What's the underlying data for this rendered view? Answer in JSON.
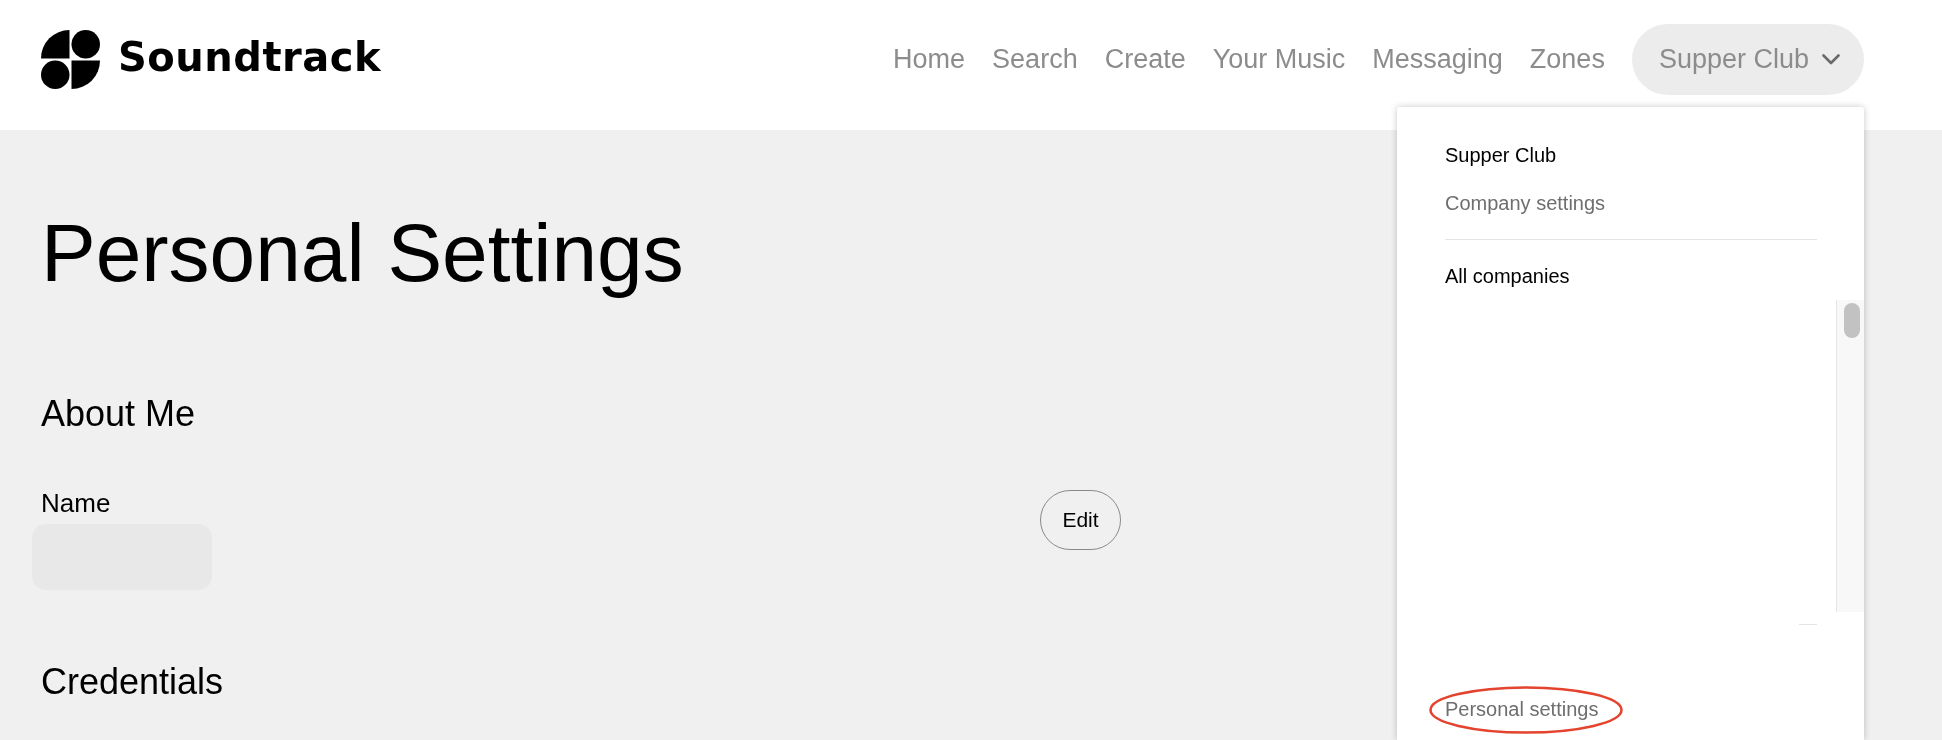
{
  "header": {
    "logo": {
      "wordmark": "Soundtrack"
    },
    "nav": [
      {
        "label": "Home",
        "selected": false
      },
      {
        "label": "Search",
        "selected": false
      },
      {
        "label": "Create",
        "selected": false
      },
      {
        "label": "Your Music",
        "selected": false
      },
      {
        "label": "Messaging",
        "selected": false
      },
      {
        "label": "Zones",
        "selected": false
      }
    ],
    "account_menu": {
      "label": "Supper Club",
      "expanded": true
    }
  },
  "page": {
    "title": "Personal Settings",
    "sections": [
      {
        "heading": "About Me",
        "fields": [
          {
            "label": "Name",
            "value_hidden": true,
            "action": "Edit"
          }
        ]
      },
      {
        "heading": "Credentials"
      }
    ]
  },
  "dropdown": {
    "company": {
      "name": "Supper Club",
      "link": "Company settings"
    },
    "all_companies": {
      "heading": "All companies"
    },
    "footer_links": [
      {
        "label": "Personal settings",
        "circled": true
      }
    ]
  }
}
